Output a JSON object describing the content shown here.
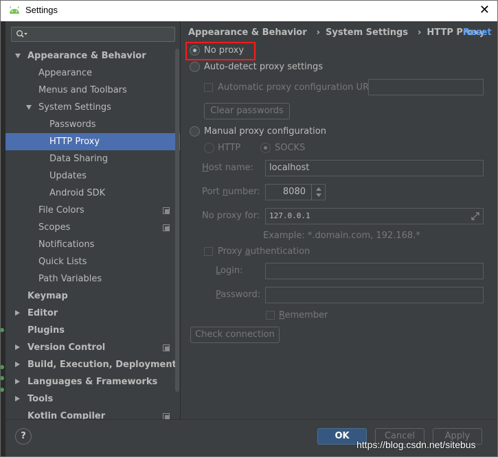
{
  "window": {
    "title": "Settings",
    "close_glyph": "✕"
  },
  "sidebar": {
    "search_placeholder": "",
    "items": [
      {
        "label": "Appearance & Behavior",
        "bold": true,
        "arrow": "down",
        "indent": 0
      },
      {
        "label": "Appearance",
        "indent": 1
      },
      {
        "label": "Menus and Toolbars",
        "indent": 1
      },
      {
        "label": "System Settings",
        "arrow": "down",
        "indent": 1
      },
      {
        "label": "Passwords",
        "indent": 2
      },
      {
        "label": "HTTP Proxy",
        "indent": 2,
        "selected": true
      },
      {
        "label": "Data Sharing",
        "indent": 2
      },
      {
        "label": "Updates",
        "indent": 2
      },
      {
        "label": "Android SDK",
        "indent": 2
      },
      {
        "label": "File Colors",
        "indent": 1,
        "copy": true
      },
      {
        "label": "Scopes",
        "indent": 1,
        "copy": true
      },
      {
        "label": "Notifications",
        "indent": 1
      },
      {
        "label": "Quick Lists",
        "indent": 1
      },
      {
        "label": "Path Variables",
        "indent": 1
      },
      {
        "label": "Keymap",
        "bold": true,
        "indent": 0
      },
      {
        "label": "Editor",
        "bold": true,
        "arrow": "right",
        "indent": 0
      },
      {
        "label": "Plugins",
        "bold": true,
        "indent": 0
      },
      {
        "label": "Version Control",
        "bold": true,
        "arrow": "right",
        "indent": 0,
        "copy": true
      },
      {
        "label": "Build, Execution, Deployment",
        "bold": true,
        "arrow": "right",
        "indent": 0
      },
      {
        "label": "Languages & Frameworks",
        "bold": true,
        "arrow": "right",
        "indent": 0
      },
      {
        "label": "Tools",
        "bold": true,
        "arrow": "right",
        "indent": 0
      },
      {
        "label": "Kotlin Compiler",
        "bold": true,
        "indent": 0,
        "copy": true
      }
    ]
  },
  "breadcrumb": {
    "part1": "Appearance & Behavior",
    "part2": "System Settings",
    "part3": "HTTP Proxy",
    "separator": "›"
  },
  "reset_label": "Reset",
  "proxy": {
    "no_proxy": "No proxy",
    "auto_detect": "Auto-detect proxy settings",
    "auto_config_url": "Automatic proxy configuration URL:",
    "auto_config_url_value": "",
    "clear_passwords": "Clear passwords",
    "manual": "Manual proxy configuration",
    "http": "HTTP",
    "socks": "SOCKS",
    "host_label_u": "H",
    "host_label_rest": "ost name:",
    "host_value": "localhost",
    "port_label_pre": "Port ",
    "port_label_u": "n",
    "port_label_rest": "umber:",
    "port_value": "8080",
    "no_proxy_for_label": "No proxy for:",
    "no_proxy_for_value": "127.0.0.1",
    "example": "Example: *.domain.com, 192.168.*",
    "auth_pre": "Proxy ",
    "auth_u": "a",
    "auth_rest": "uthentication",
    "login_u": "L",
    "login_rest": "ogin:",
    "login_value": "",
    "password_u": "P",
    "password_rest": "assword:",
    "password_value": "",
    "remember_u": "R",
    "remember_rest": "emember",
    "check_connection": "Check connection"
  },
  "footer": {
    "help": "?",
    "ok": "OK",
    "cancel": "Cancel",
    "apply": "Apply"
  },
  "watermark": "https://blog.csdn.net/sitebus",
  "colors": {
    "accent": "#4b6eaf",
    "link": "#589df6",
    "highlight": "#ff1a1a",
    "ok_button": "#365880"
  }
}
